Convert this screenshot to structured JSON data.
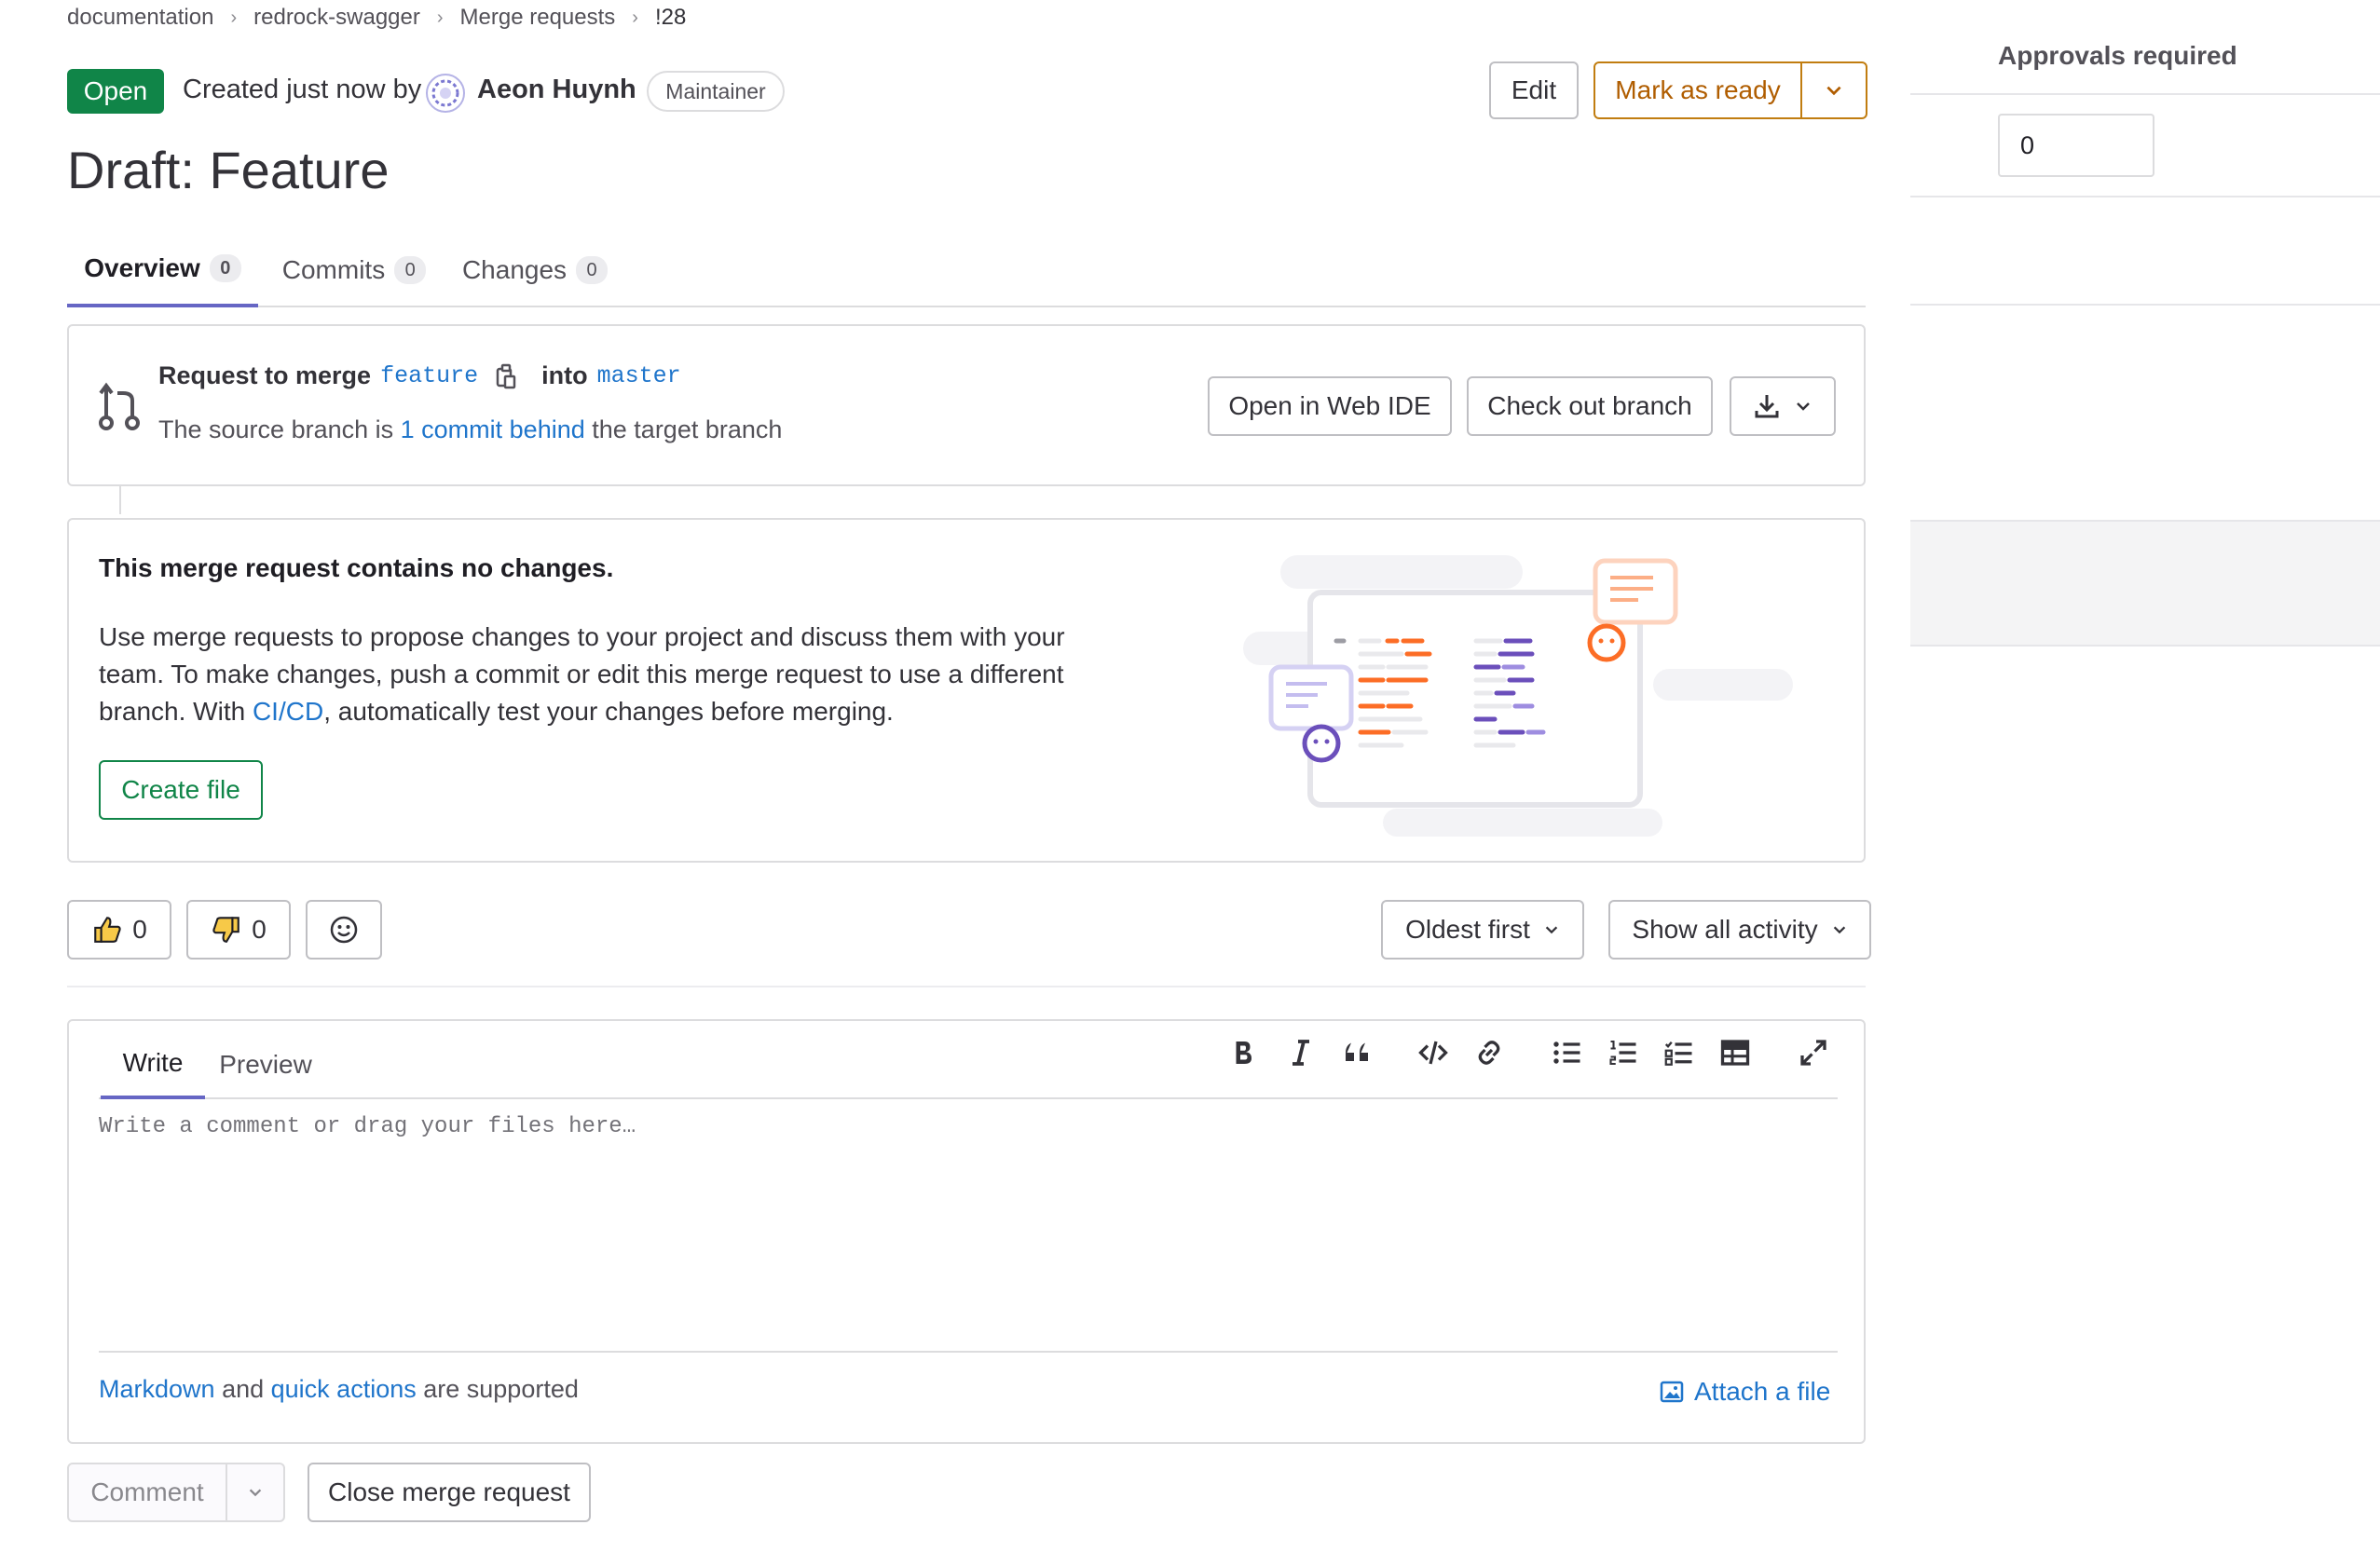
{
  "breadcrumb": {
    "items": [
      "documentation",
      "redrock-swagger",
      "Merge requests",
      "!28"
    ]
  },
  "header": {
    "status": "Open",
    "created_prefix": "Created just now by",
    "author": "Aeon Huynh",
    "role": "Maintainer",
    "edit_label": "Edit",
    "mark_ready_label": "Mark as ready",
    "title": "Draft: Feature"
  },
  "tabs": [
    {
      "label": "Overview",
      "count": "0"
    },
    {
      "label": "Commits",
      "count": "0"
    },
    {
      "label": "Changes",
      "count": "0"
    }
  ],
  "merge_info": {
    "request_label": "Request to merge",
    "source": "feature",
    "into_label": "into",
    "target": "master",
    "behind_prefix": "The source branch is",
    "behind_link": "1 commit behind",
    "behind_suffix": "the target branch",
    "web_ide_label": "Open in Web IDE",
    "checkout_label": "Check out branch"
  },
  "empty_state": {
    "heading": "This merge request contains no changes.",
    "line1": "Use merge requests to propose changes to your project and discuss them with your",
    "line2": "team. To make changes, push a commit or edit this merge request to use a different",
    "line3_prefix": "branch. With",
    "line3_link": "CI/CD",
    "line3_suffix": ", automatically test your changes before merging.",
    "create_file_label": "Create file"
  },
  "reactions": {
    "thumbs_up": "0",
    "thumbs_down": "0"
  },
  "activity": {
    "sort_label": "Oldest first",
    "filter_label": "Show all activity"
  },
  "editor": {
    "write_tab": "Write",
    "preview_tab": "Preview",
    "placeholder": "Write a comment or drag your files here…",
    "markdown_link": "Markdown",
    "and_text": "and",
    "quick_actions_link": "quick actions",
    "supported_text": "are supported",
    "attach_label": "Attach a file"
  },
  "actions": {
    "comment_label": "Comment",
    "close_label": "Close merge request"
  },
  "sidebar": {
    "approvals_label": "Approvals required",
    "approvals_value": "0"
  },
  "colors": {
    "status_green": "#108548",
    "link_blue": "#1f75cb",
    "ready_orange": "#c17d10",
    "tab_active": "#6666c4"
  }
}
